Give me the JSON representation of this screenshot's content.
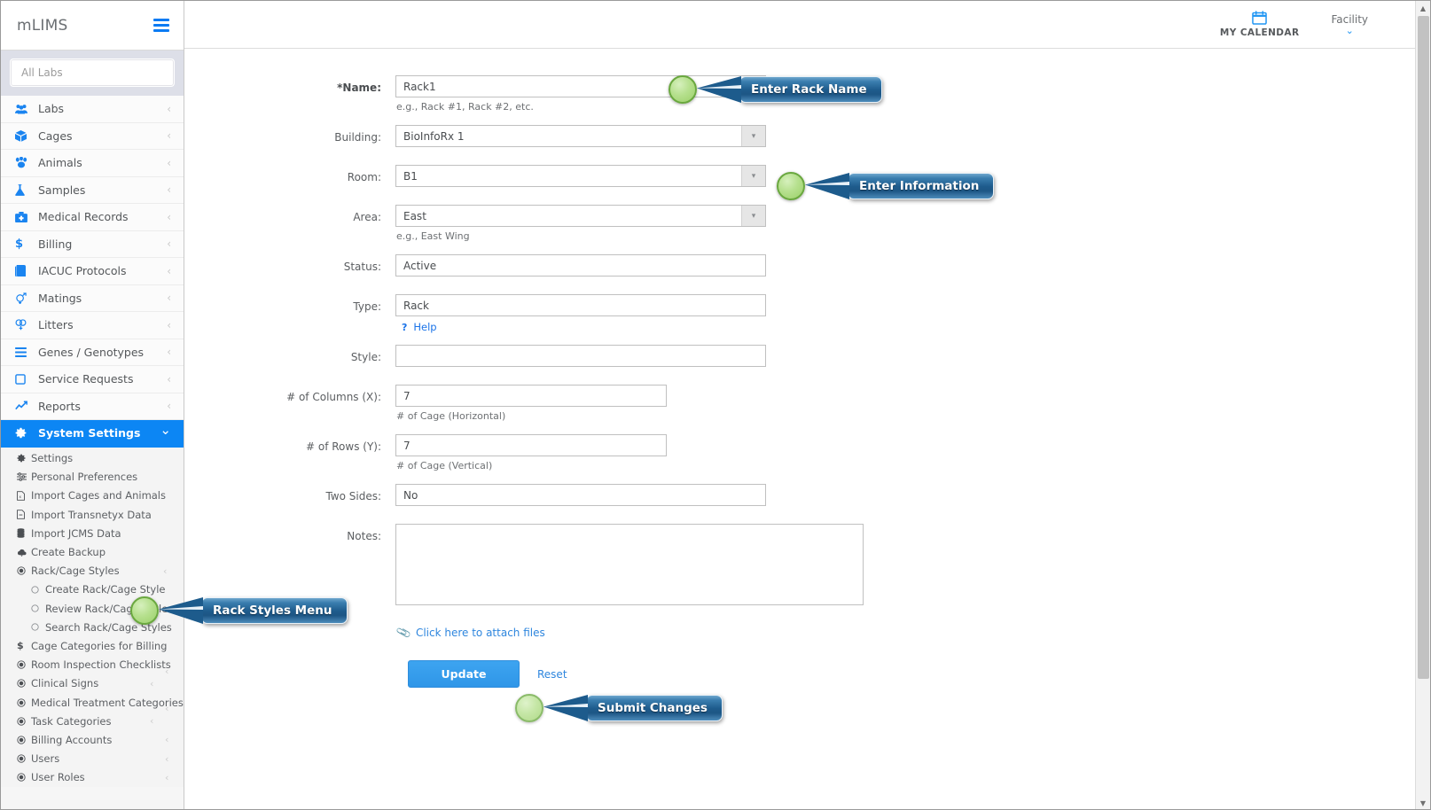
{
  "brand": {
    "title": "mLIMS",
    "menu_icon": "hamburger-icon"
  },
  "lab_search": {
    "placeholder": "All Labs",
    "value": ""
  },
  "sidebar": {
    "items": [
      {
        "label": "Labs",
        "icon": "users-group-icon",
        "chevron": "‹"
      },
      {
        "label": "Cages",
        "icon": "box-icon",
        "chevron": "‹"
      },
      {
        "label": "Animals",
        "icon": "paw-icon",
        "chevron": "‹"
      },
      {
        "label": "Samples",
        "icon": "flask-icon",
        "chevron": "‹"
      },
      {
        "label": "Medical Records",
        "icon": "medkit-icon",
        "chevron": "‹"
      },
      {
        "label": "Billing",
        "icon": "dollar-icon",
        "chevron": "‹"
      },
      {
        "label": "IACUC Protocols",
        "icon": "book-icon",
        "chevron": "‹"
      },
      {
        "label": "Matings",
        "icon": "mating-icon",
        "chevron": "‹"
      },
      {
        "label": "Litters",
        "icon": "litters-icon",
        "chevron": "‹"
      },
      {
        "label": "Genes / Genotypes",
        "icon": "bars-icon",
        "chevron": "‹"
      },
      {
        "label": "Service Requests",
        "icon": "note-icon",
        "chevron": "‹"
      },
      {
        "label": "Reports",
        "icon": "chart-line-icon",
        "chevron": "‹"
      }
    ],
    "active_item": {
      "label": "System Settings",
      "icon": "gear-icon",
      "chevron": "⌄"
    },
    "sub_items": [
      {
        "label": "Settings",
        "icon": "gear-icon",
        "level": 1,
        "chevron": ""
      },
      {
        "label": "Personal Preferences",
        "icon": "sliders-icon",
        "level": 1,
        "chevron": ""
      },
      {
        "label": "Import Cages and Animals",
        "icon": "file-import-icon",
        "level": 1,
        "chevron": ""
      },
      {
        "label": "Import Transnetyx Data",
        "icon": "file-icon",
        "level": 1,
        "chevron": ""
      },
      {
        "label": "Import JCMS Data",
        "icon": "database-icon",
        "level": 1,
        "chevron": ""
      },
      {
        "label": "Create Backup",
        "icon": "cloud-download-icon",
        "level": 1,
        "chevron": ""
      },
      {
        "label": "Rack/Cage Styles",
        "icon": "radio-dot-icon",
        "level": 1,
        "chevron": "‹"
      },
      {
        "label": "Create Rack/Cage Style",
        "icon": "circle-icon",
        "level": 2,
        "chevron": ""
      },
      {
        "label": "Review Rack/Cage Styles",
        "icon": "circle-icon",
        "level": 2,
        "chevron": ""
      },
      {
        "label": "Search Rack/Cage Styles",
        "icon": "circle-icon",
        "level": 2,
        "chevron": ""
      },
      {
        "label": "Cage Categories for Billing",
        "icon": "dollar-icon",
        "level": 1,
        "chevron": "‹"
      },
      {
        "label": "Room Inspection Checklists",
        "icon": "radio-dot-icon",
        "level": 1,
        "chevron": "‹"
      },
      {
        "label": "Clinical Signs",
        "icon": "radio-dot-icon",
        "level": 1,
        "chevron": "‹"
      },
      {
        "label": "Medical Treatment Categories",
        "icon": "radio-dot-icon",
        "level": 1,
        "chevron": "‹"
      },
      {
        "label": "Task Categories",
        "icon": "radio-dot-icon",
        "level": 1,
        "chevron": "‹"
      },
      {
        "label": "Billing Accounts",
        "icon": "radio-dot-icon",
        "level": 1,
        "chevron": "‹"
      },
      {
        "label": "Users",
        "icon": "radio-dot-icon",
        "level": 1,
        "chevron": "‹"
      },
      {
        "label": "User Roles",
        "icon": "radio-dot-icon",
        "level": 1,
        "chevron": "‹"
      }
    ]
  },
  "topbar": {
    "calendar": {
      "label": "MY CALENDAR",
      "icon": "calendar-icon"
    },
    "facility": {
      "label": "Facility",
      "chevron": "⌄"
    }
  },
  "form": {
    "name": {
      "label": "*Name:",
      "value": "Rack1",
      "hint": "e.g., Rack #1, Rack #2, etc."
    },
    "building": {
      "label": "Building:",
      "value": "BioInfoRx 1"
    },
    "room": {
      "label": "Room:",
      "value": "B1"
    },
    "area": {
      "label": "Area:",
      "value": "East",
      "hint": "e.g., East Wing"
    },
    "status": {
      "label": "Status:",
      "value": "Active"
    },
    "type": {
      "label": "Type:",
      "value": "Rack",
      "help_label": "Help",
      "help_icon": "question-icon"
    },
    "style": {
      "label": "Style:",
      "value": ""
    },
    "columns": {
      "label": "# of Columns (X):",
      "value": "7",
      "hint": "# of Cage (Horizontal)"
    },
    "rows": {
      "label": "# of Rows (Y):",
      "value": "7",
      "hint": "# of Cage (Vertical)"
    },
    "two_sides": {
      "label": "Two Sides:",
      "value": "No"
    },
    "notes": {
      "label": "Notes:",
      "value": ""
    },
    "attach": {
      "label": "Click here to attach files",
      "icon": "paperclip-icon"
    },
    "update_button": "Update",
    "reset_button": "Reset"
  },
  "callouts": {
    "name": "Enter Rack Name",
    "room": "Enter Information",
    "rack_styles": "Rack Styles Menu",
    "submit": "Submit Changes"
  },
  "colors": {
    "accent": "#0c86f4",
    "callout_bubble": "#1e5b8c",
    "callout_dot": "#9bd069",
    "button": "#2f96e8",
    "link": "#2e86de"
  }
}
